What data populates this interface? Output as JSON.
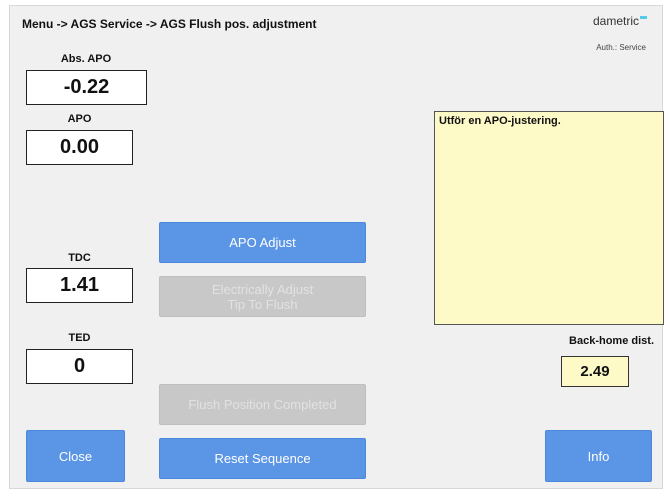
{
  "header": {
    "breadcrumb": "Menu -> AGS Service -> AGS Flush pos. adjustment",
    "brand": "dametric",
    "auth": "Auth.: Service"
  },
  "readouts": {
    "abs_apo": {
      "label": "Abs. APO",
      "value": "-0.22"
    },
    "apo": {
      "label": "APO",
      "value": "0.00"
    },
    "tdc": {
      "label": "TDC",
      "value": "1.41"
    },
    "ted": {
      "label": "TED",
      "value": "0"
    }
  },
  "buttons": {
    "apo_adjust": "APO Adjust",
    "electrically_adjust": "Electrically Adjust\nTip To Flush",
    "flush_completed": "Flush Position Completed",
    "close": "Close",
    "reset_sequence": "Reset Sequence",
    "info": "Info"
  },
  "message": "Utför en APO-justering.",
  "back_home": {
    "label": "Back-home dist.",
    "value": "2.49"
  },
  "colors": {
    "button_blue": "#5b95e6",
    "button_disabled": "#c8c8c8",
    "message_bg": "#fdfac8",
    "brand_accent": "#56c8e8"
  }
}
